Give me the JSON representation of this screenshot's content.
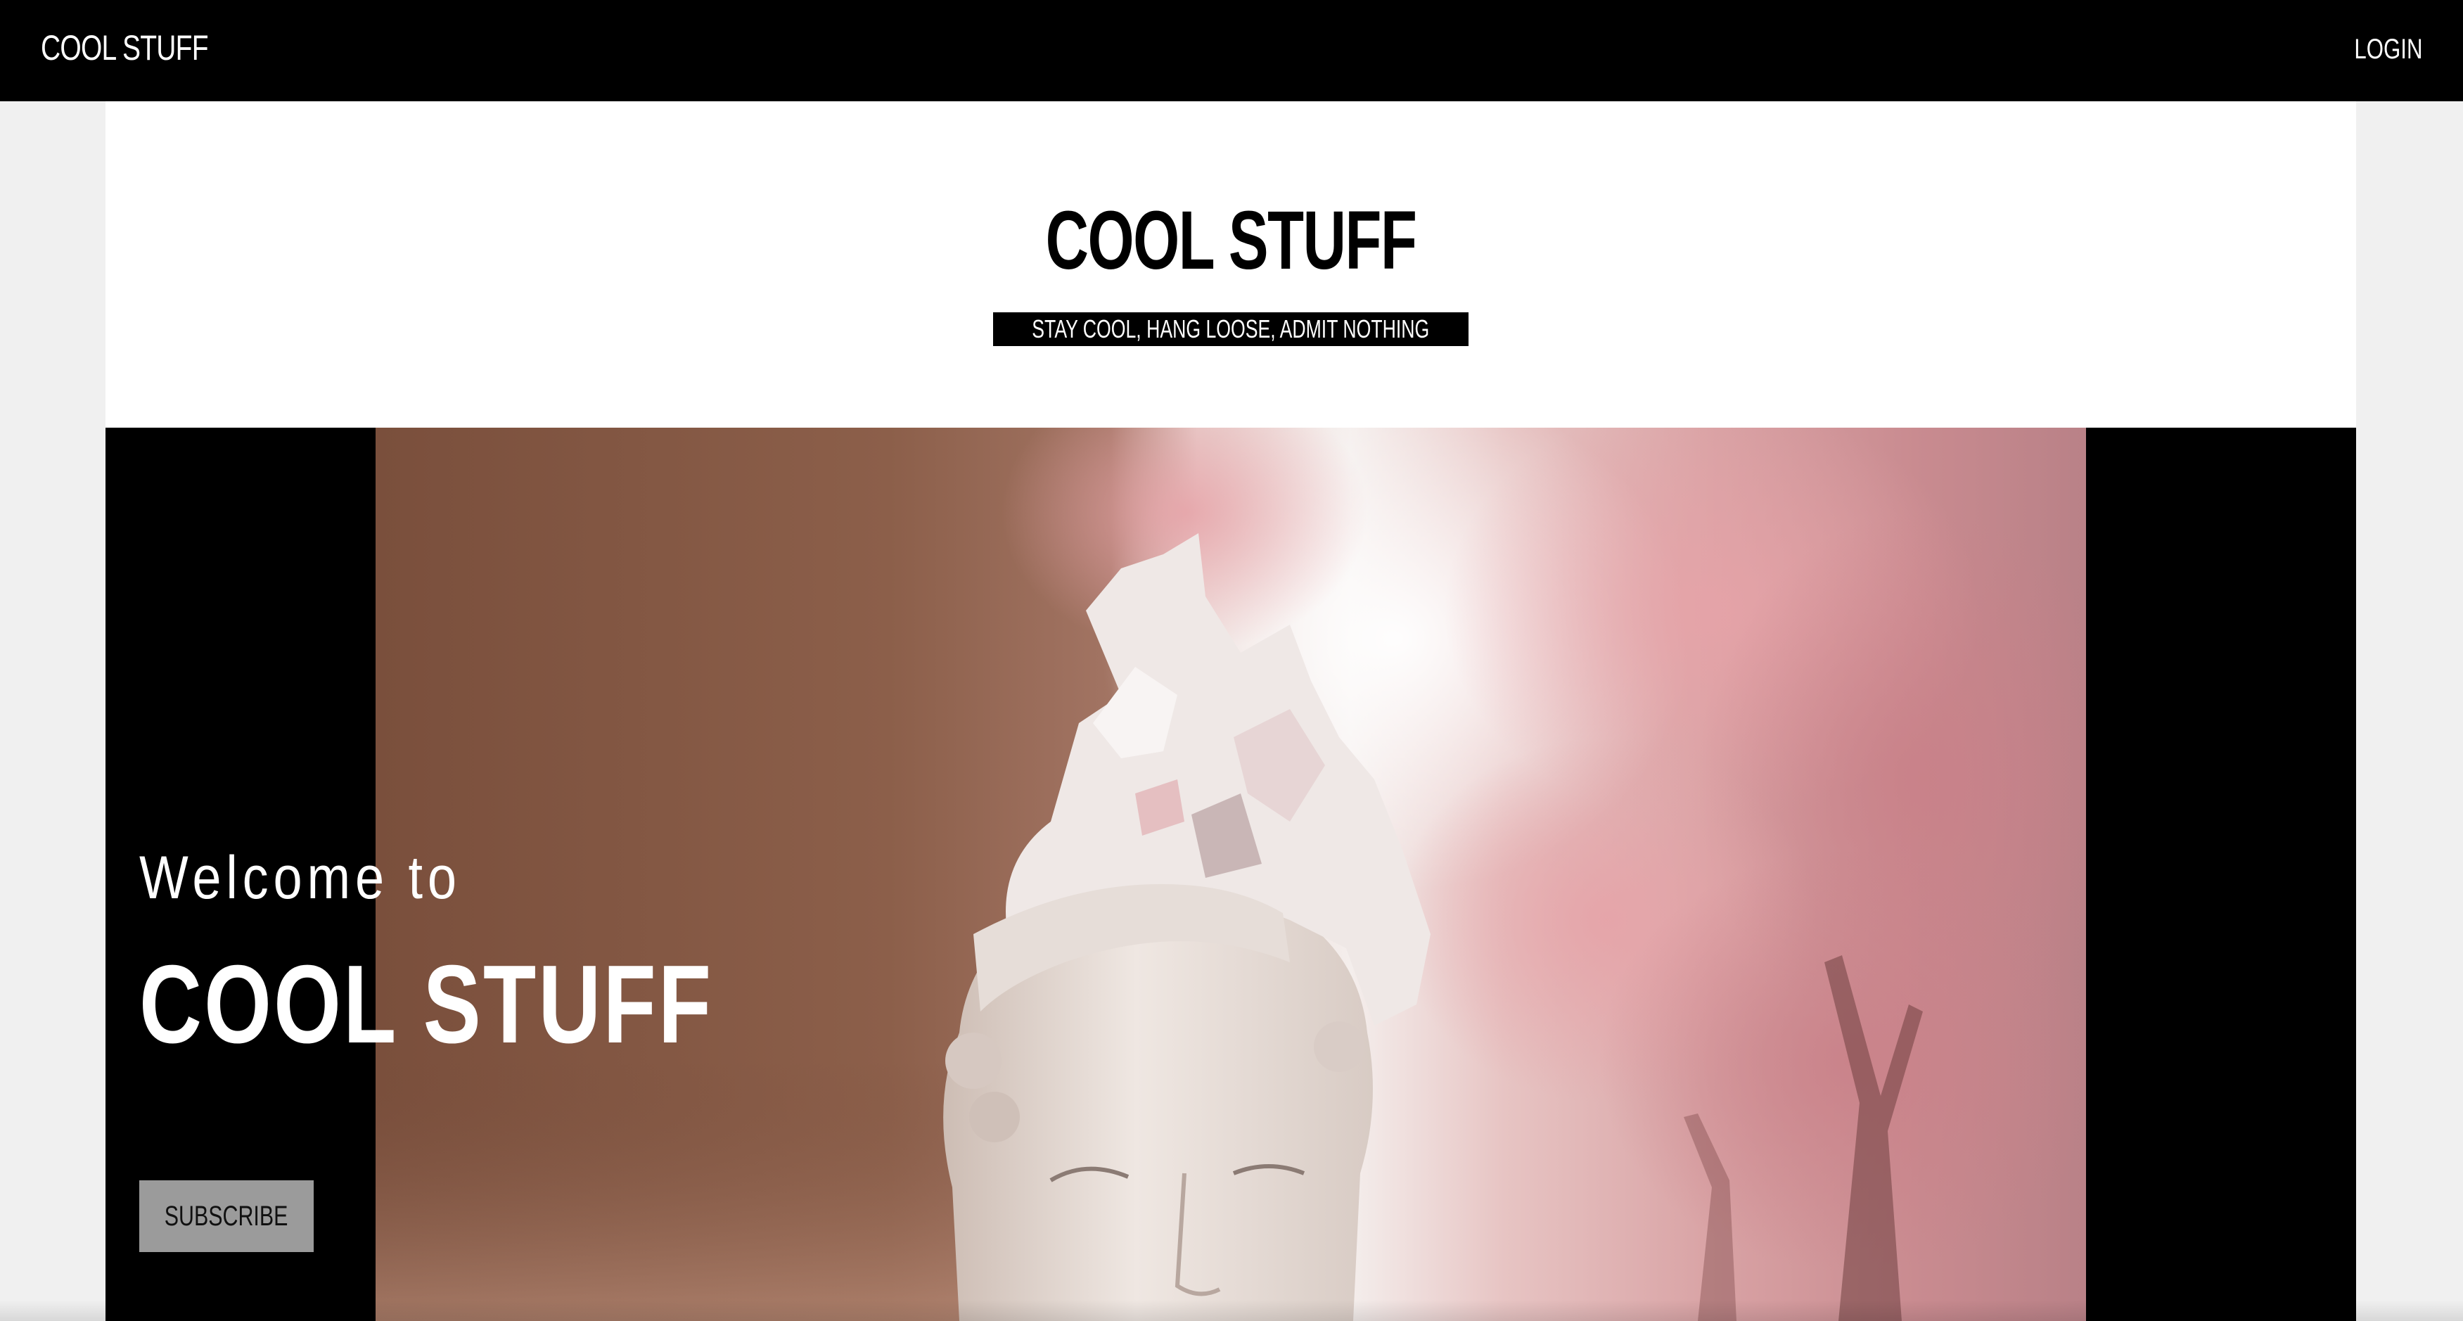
{
  "nav": {
    "brand": "COOL STUFF",
    "login_label": "LOGIN"
  },
  "masthead": {
    "title": "COOL STUFF",
    "tagline": "STAY COOL, HANG LOOSE, ADMIT NOTHING"
  },
  "hero": {
    "welcome": "Welcome to",
    "title": "COOL STUFF",
    "subscribe_label": "SUBSCRIBE",
    "media_description_icon": "statue-head-image"
  },
  "colors": {
    "nav_background": "#000000",
    "page_background": "#f0f0f0",
    "content_background": "#ffffff",
    "button_background": "#9b9b9b",
    "tagline_background": "#000000"
  }
}
